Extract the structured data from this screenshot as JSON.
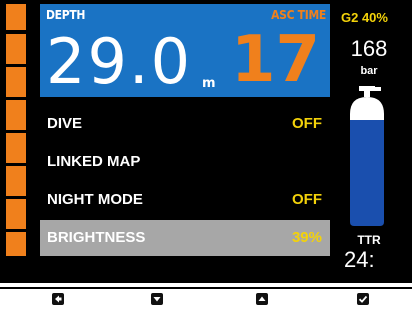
{
  "depth": {
    "label": "DEPTH",
    "value": "29.0",
    "unit": "m"
  },
  "ascent": {
    "label": "ASC TIME",
    "value": "17"
  },
  "gas": {
    "label": "G2 40%",
    "pressure_value": "168",
    "pressure_unit": "bar"
  },
  "ttr": {
    "label": "TTR",
    "value": "24:"
  },
  "menu": {
    "items": [
      {
        "label": "DIVE",
        "value": "OFF"
      },
      {
        "label": "LINKED MAP",
        "value": ""
      },
      {
        "label": "NIGHT MODE",
        "value": "OFF"
      },
      {
        "label": "BRIGHTNESS",
        "value": "39%"
      }
    ],
    "selected_index": 3
  },
  "buttons": [
    {
      "name": "back-button",
      "icon": "arrow-left-icon"
    },
    {
      "name": "down-button",
      "icon": "arrow-down-icon"
    },
    {
      "name": "up-button",
      "icon": "arrow-up-icon"
    },
    {
      "name": "confirm-button",
      "icon": "checkmark-icon"
    }
  ],
  "colors": {
    "ascent_orange": "#f0801c",
    "depth_blue": "#1a73c4",
    "value_yellow": "#f3d20a",
    "selected_gray": "#a7a7a7",
    "tank_blue": "#1a4fae"
  }
}
